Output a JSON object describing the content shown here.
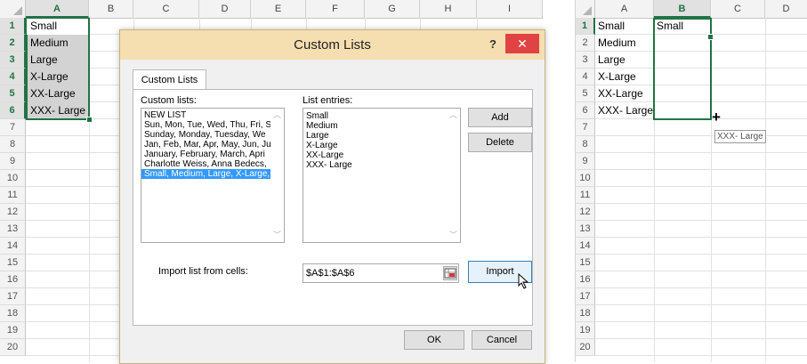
{
  "left_sheet": {
    "columns": [
      "A",
      "B",
      "C",
      "D",
      "E",
      "F",
      "G",
      "H",
      "I"
    ],
    "rows": [
      "1",
      "2",
      "3",
      "4",
      "5",
      "6",
      "7",
      "8",
      "9",
      "10",
      "11",
      "12",
      "13",
      "14",
      "15",
      "16",
      "17",
      "18",
      "19",
      "20"
    ],
    "selected_column": "A",
    "cells_a": [
      "Small",
      "Medium",
      "Large",
      "X-Large",
      "XX-Large",
      "XXX- Large"
    ]
  },
  "dialog": {
    "title": "Custom Lists",
    "help": "?",
    "close": "✕",
    "tab": "Custom Lists",
    "custom_lists_label": "Custom lists:",
    "list_entries_label": "List entries:",
    "custom_lists": [
      "NEW LIST",
      "Sun, Mon, Tue, Wed, Thu, Fri, S",
      "Sunday, Monday, Tuesday, We",
      "Jan, Feb, Mar, Apr, May, Jun, Ju",
      "January, February, March, Apri",
      "Charlotte Weiss, Anna Bedecs,",
      "Small, Medium, Large, X-Large,"
    ],
    "selected_list_index": 6,
    "list_entries": [
      "Small",
      "Medium",
      "Large",
      "X-Large",
      "XX-Large",
      "XXX- Large"
    ],
    "add_label": "Add",
    "delete_label": "Delete",
    "import_from_label": "Import list from cells:",
    "import_range": "$A$1:$A$6",
    "import_label": "Import",
    "ok_label": "OK",
    "cancel_label": "Cancel"
  },
  "right_sheet": {
    "columns": [
      "A",
      "B",
      "C",
      "D"
    ],
    "rows": [
      "1",
      "2",
      "3",
      "4",
      "5",
      "6",
      "7",
      "8",
      "9",
      "10",
      "11",
      "12",
      "13",
      "14",
      "15",
      "16",
      "17",
      "18",
      "19",
      "20"
    ],
    "selected_column": "B",
    "cells_a": [
      "Small",
      "Medium",
      "Large",
      "X-Large",
      "XX-Large",
      "XXX- Large"
    ],
    "cell_b1": "Small",
    "fill_tooltip": "XXX- Large"
  },
  "colors": {
    "excel_green": "#217346",
    "title_bar": "#f5deb0",
    "close_red": "#e04343",
    "selection_blue": "#3399ff"
  },
  "icons": [
    "range-picker-icon",
    "mouse-pointer-icon",
    "fill-crosshair-icon",
    "scroll-up-icon",
    "scroll-down-icon"
  ]
}
